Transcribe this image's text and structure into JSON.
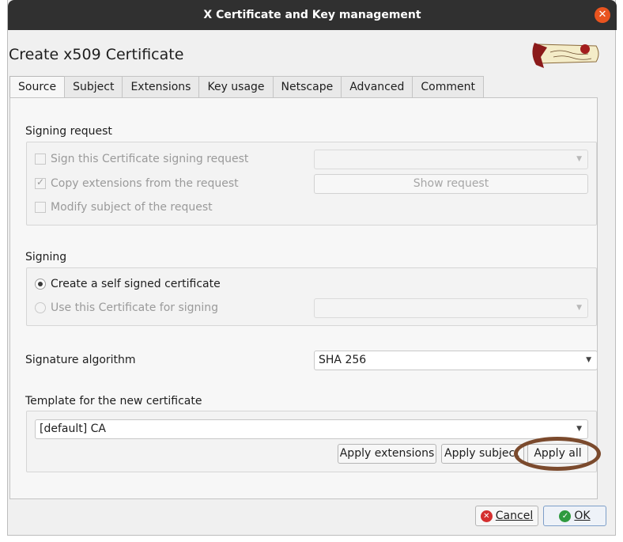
{
  "window": {
    "title": "X Certificate and Key management"
  },
  "dialog": {
    "heading": "Create x509 Certificate"
  },
  "tabs": [
    "Source",
    "Subject",
    "Extensions",
    "Key usage",
    "Netscape",
    "Advanced",
    "Comment"
  ],
  "signing_request": {
    "label": "Signing request",
    "sign_csr": "Sign this Certificate signing request",
    "copy_extensions": "Copy extensions from the request",
    "modify_subject": "Modify subject of the request",
    "show_request": "Show request",
    "request_select": ""
  },
  "signing": {
    "label": "Signing",
    "self_signed": "Create a self signed certificate",
    "use_cert": "Use this Certificate for signing",
    "cert_select": ""
  },
  "signature": {
    "label": "Signature algorithm",
    "value": "SHA 256"
  },
  "template": {
    "label": "Template for the new certificate",
    "value": "[default] CA",
    "apply_extensions": "Apply extensions",
    "apply_subject": "Apply subject",
    "apply_all": "Apply all"
  },
  "footer": {
    "cancel": "Cancel",
    "ok": "OK"
  },
  "colors": {
    "highlight": "#7b4a2d",
    "titlebar": "#303030",
    "close": "#e9541f"
  },
  "icons": {
    "close": "close-icon",
    "cancel": "cancel-icon",
    "ok": "ok-icon",
    "logo": "scroll-logo"
  }
}
